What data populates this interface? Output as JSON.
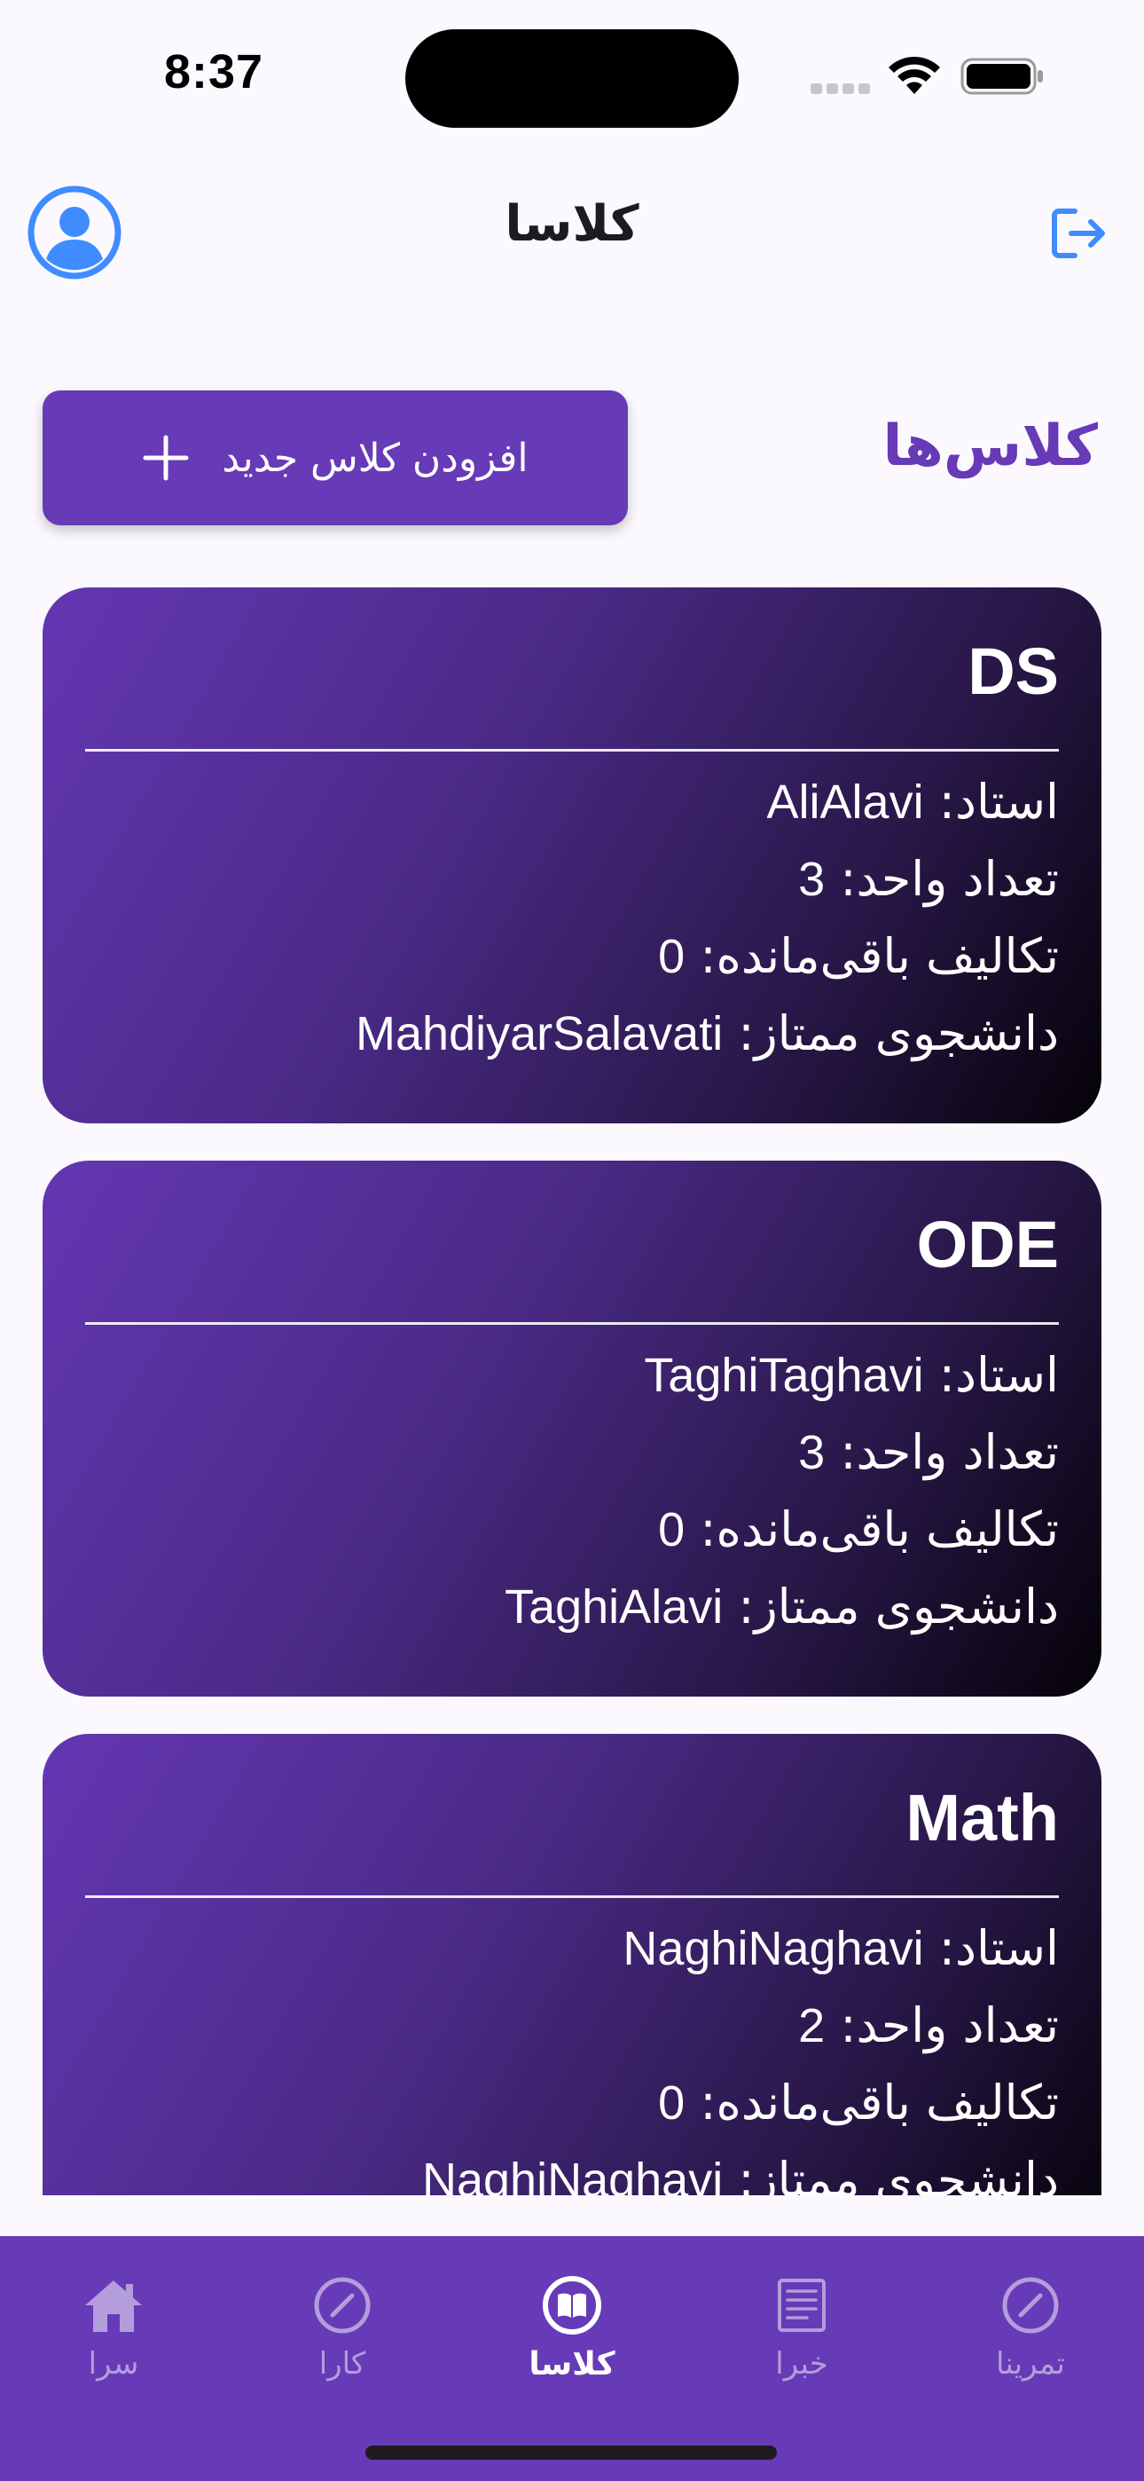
{
  "status_bar": {
    "time": "8:37"
  },
  "app_bar": {
    "title": "کلاسا",
    "avatar_icon": "account-circle-icon",
    "logout_icon": "logout-icon"
  },
  "section": {
    "title": "کلاس‌ها",
    "add_button_label": "افزودن کلاس جدید",
    "add_button_icon": "plus-icon"
  },
  "classes": [
    {
      "name": "DS",
      "teacher_label": "استاد:",
      "teacher": "AliAlavi",
      "units_label": "تعداد واحد:",
      "units": "3",
      "remaining_label": "تکالیف باقی‌مانده:",
      "remaining": "0",
      "top_student_label": "دانشجوی ممتاز:",
      "top_student": "MahdiyarSalavati"
    },
    {
      "name": "ODE",
      "teacher_label": "استاد:",
      "teacher": "TaghiTaghavi",
      "units_label": "تعداد واحد:",
      "units": "3",
      "remaining_label": "تکالیف باقی‌مانده:",
      "remaining": "0",
      "top_student_label": "دانشجوی ممتاز:",
      "top_student": "TaghiAlavi"
    },
    {
      "name": "Math",
      "teacher_label": "استاد:",
      "teacher": "NaghiNaghavi",
      "units_label": "تعداد واحد:",
      "units": "2",
      "remaining_label": "تکالیف باقی‌مانده:",
      "remaining": "0",
      "top_student_label": "دانشجوی ممتاز:",
      "top_student": "NaghiNaghavi"
    }
  ],
  "bottom_nav": {
    "items": [
      {
        "label": "سرا",
        "icon": "home-icon",
        "active": false
      },
      {
        "label": "کارا",
        "icon": "compass-icon",
        "active": false
      },
      {
        "label": "کلاسا",
        "icon": "book-icon",
        "active": true
      },
      {
        "label": "خبرا",
        "icon": "news-icon",
        "active": false
      },
      {
        "label": "تمرینا",
        "icon": "compass-icon",
        "active": false
      }
    ]
  },
  "colors": {
    "primary": "#673AB7",
    "nav_inactive": "#B39DDB",
    "icon_blue": "#3F8CFF",
    "background": "#FBF9FE"
  }
}
